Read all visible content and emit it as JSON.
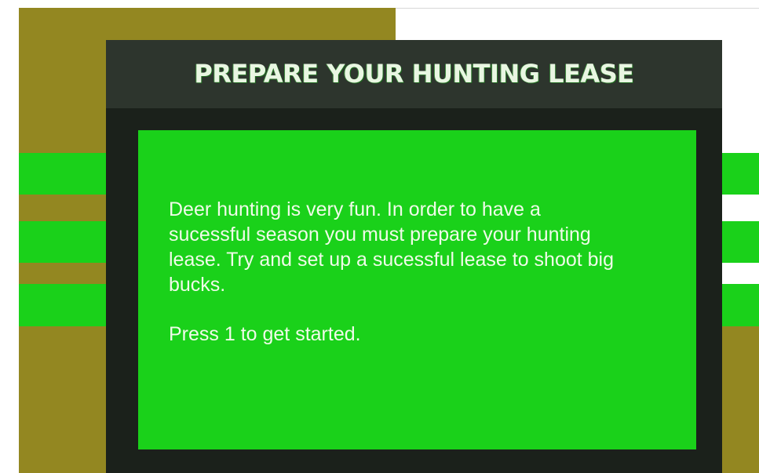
{
  "game": {
    "title": "PREPARE YOUR HUNTING LEASE",
    "intro_text": "Deer hunting is very fun.  In order to have a\nsucessful season you must prepare your hunting\nlease.  Try and set up a sucessful lease to shoot big\nbucks.",
    "prompt": "Press 1 to get started."
  },
  "colors": {
    "background_olive": "#938721",
    "stripe_green": "#1ad11a",
    "panel_dark": "#1b211b",
    "header_dark": "#2d352d",
    "text_light": "#f0fbe9"
  }
}
